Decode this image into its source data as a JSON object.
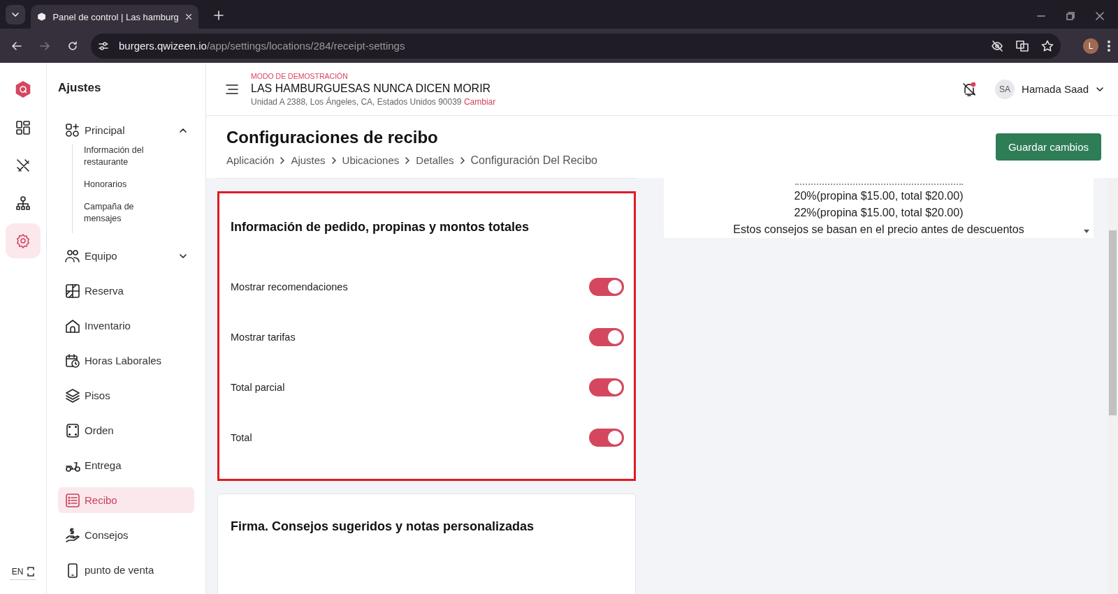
{
  "browser": {
    "tab_title": "Panel de control | Las hamburg",
    "url_host": "burgers.qwizeen.io",
    "url_path": "/app/settings/locations/284/receipt-settings",
    "profile": "L"
  },
  "rail": {
    "items": [
      {
        "selected": false
      },
      {
        "selected": false
      },
      {
        "selected": false
      },
      {
        "selected": true
      }
    ],
    "language": "EN"
  },
  "settings_nav": {
    "title": "Ajustes",
    "items": [
      {
        "label": "Principal",
        "expanded": true,
        "selected": false,
        "children": [
          {
            "label": "Información del restaurante"
          },
          {
            "label": "Honorarios"
          },
          {
            "label": "Campaña de mensajes"
          }
        ]
      },
      {
        "label": "Equipo",
        "expanded": false,
        "selected": false
      },
      {
        "label": "Reserva",
        "selected": false
      },
      {
        "label": "Inventario",
        "selected": false
      },
      {
        "label": "Horas Laborales",
        "selected": false
      },
      {
        "label": "Pisos",
        "selected": false
      },
      {
        "label": "Orden",
        "selected": false
      },
      {
        "label": "Entrega",
        "selected": false
      },
      {
        "label": "Recibo",
        "selected": true
      },
      {
        "label": "Consejos",
        "selected": false
      },
      {
        "label": "punto de venta",
        "selected": false
      }
    ]
  },
  "header": {
    "demo_label": "MODO DE DEMOSTRACIÓN",
    "restaurant": "LAS HAMBURGUESAS NUNCA DICEN MORIR",
    "address": "Unidad A 2388, Los Ángeles, CA, Estados Unidos 90039",
    "change_link": "Cambiar",
    "user_initials": "SA",
    "user_name": "Hamada Saad"
  },
  "page": {
    "title": "Configuraciones de recibo",
    "breadcrumbs": [
      "Aplicación",
      "Ajustes",
      "Ubicaciones",
      "Detalles",
      "Configuración Del Recibo"
    ],
    "save_button": "Guardar cambios"
  },
  "sections": [
    {
      "title": "Información de pedido, propinas y montos totales",
      "highlighted": true,
      "settings": [
        {
          "label": "Mostrar recomendaciones",
          "on": true
        },
        {
          "label": "Mostrar tarifas",
          "on": true
        },
        {
          "label": "Total parcial",
          "on": true
        },
        {
          "label": "Total",
          "on": true
        }
      ]
    },
    {
      "title": "Firma. Consejos sugeridos y notas personalizadas",
      "highlighted": false
    }
  ],
  "preview": {
    "lines": [
      "20%(propina $15.00, total $20.00)",
      "22%(propina $15.00, total $20.00)",
      "Estos consejos se basan en el precio antes de descuentos"
    ]
  }
}
